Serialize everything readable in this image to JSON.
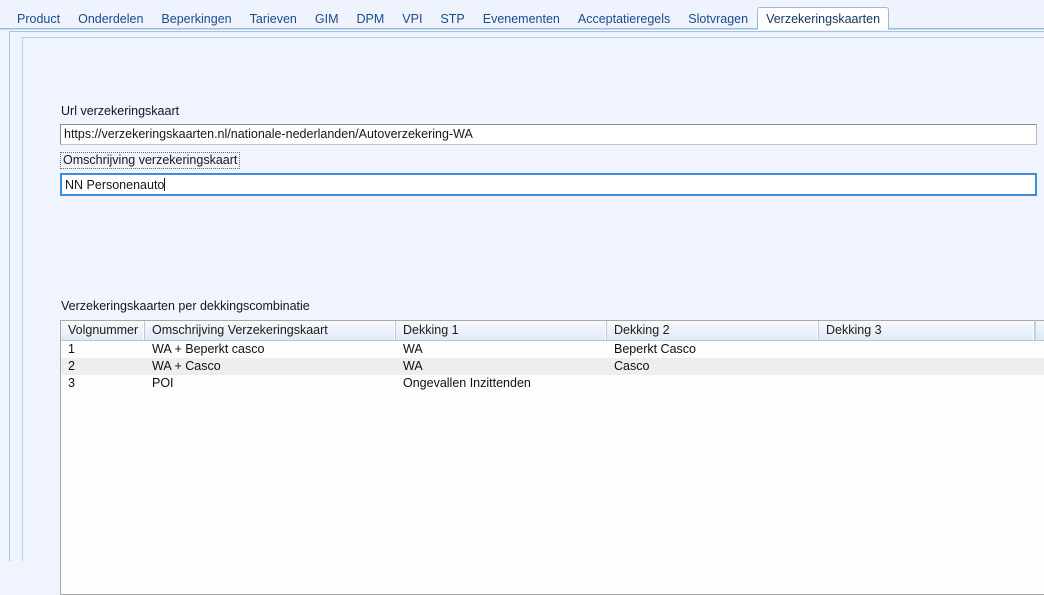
{
  "window": {
    "title": "Verzekeringskaarten"
  },
  "tabs": {
    "items": [
      {
        "label": "Product",
        "active": false
      },
      {
        "label": "Onderdelen",
        "active": false
      },
      {
        "label": "Beperkingen",
        "active": false
      },
      {
        "label": "Tarieven",
        "active": false
      },
      {
        "label": "GIM",
        "active": false
      },
      {
        "label": "DPM",
        "active": false
      },
      {
        "label": "VPI",
        "active": false
      },
      {
        "label": "STP",
        "active": false
      },
      {
        "label": "Evenementen",
        "active": false
      },
      {
        "label": "Acceptatieregels",
        "active": false
      },
      {
        "label": "Slotvragen",
        "active": false
      },
      {
        "label": "Verzekeringskaarten",
        "active": true
      }
    ]
  },
  "form": {
    "url": {
      "label": "Url verzekeringskaart",
      "value": "https://verzekeringskaarten.nl/nationale-nederlanden/Autoverzekering-WA",
      "placeholder": ""
    },
    "description": {
      "label": "Omschrijving verzekeringskaart",
      "value": "NN Personenauto",
      "placeholder": "",
      "focused": true
    }
  },
  "grid": {
    "caption": "Verzekeringskaarten per dekkingscombinatie",
    "columns": [
      "Volgnummer",
      "Omschrijving Verzekeringskaart",
      "Dekking 1",
      "Dekking 2",
      "Dekking 3"
    ],
    "rows": [
      {
        "volgnummer": "1",
        "omschrijving": "WA + Beperkt casco",
        "dekking1": "WA",
        "dekking2": "Beperkt Casco",
        "dekking3": ""
      },
      {
        "volgnummer": "2",
        "omschrijving": "WA + Casco",
        "dekking1": "WA",
        "dekking2": "Casco",
        "dekking3": ""
      },
      {
        "volgnummer": "3",
        "omschrijving": "POI",
        "dekking1": "Ongevallen Inzittenden",
        "dekking2": "",
        "dekking3": ""
      }
    ]
  },
  "colors": {
    "panel_background": "#eff4fe",
    "tab_text": "#1b4b8f",
    "active_tab_background": "#ffffff",
    "grid_background": "#fdfdfb",
    "grid_header_border": "#b6c9dd",
    "focus_border": "#3d8ddd",
    "alt_row_background": "#eeeeee"
  }
}
